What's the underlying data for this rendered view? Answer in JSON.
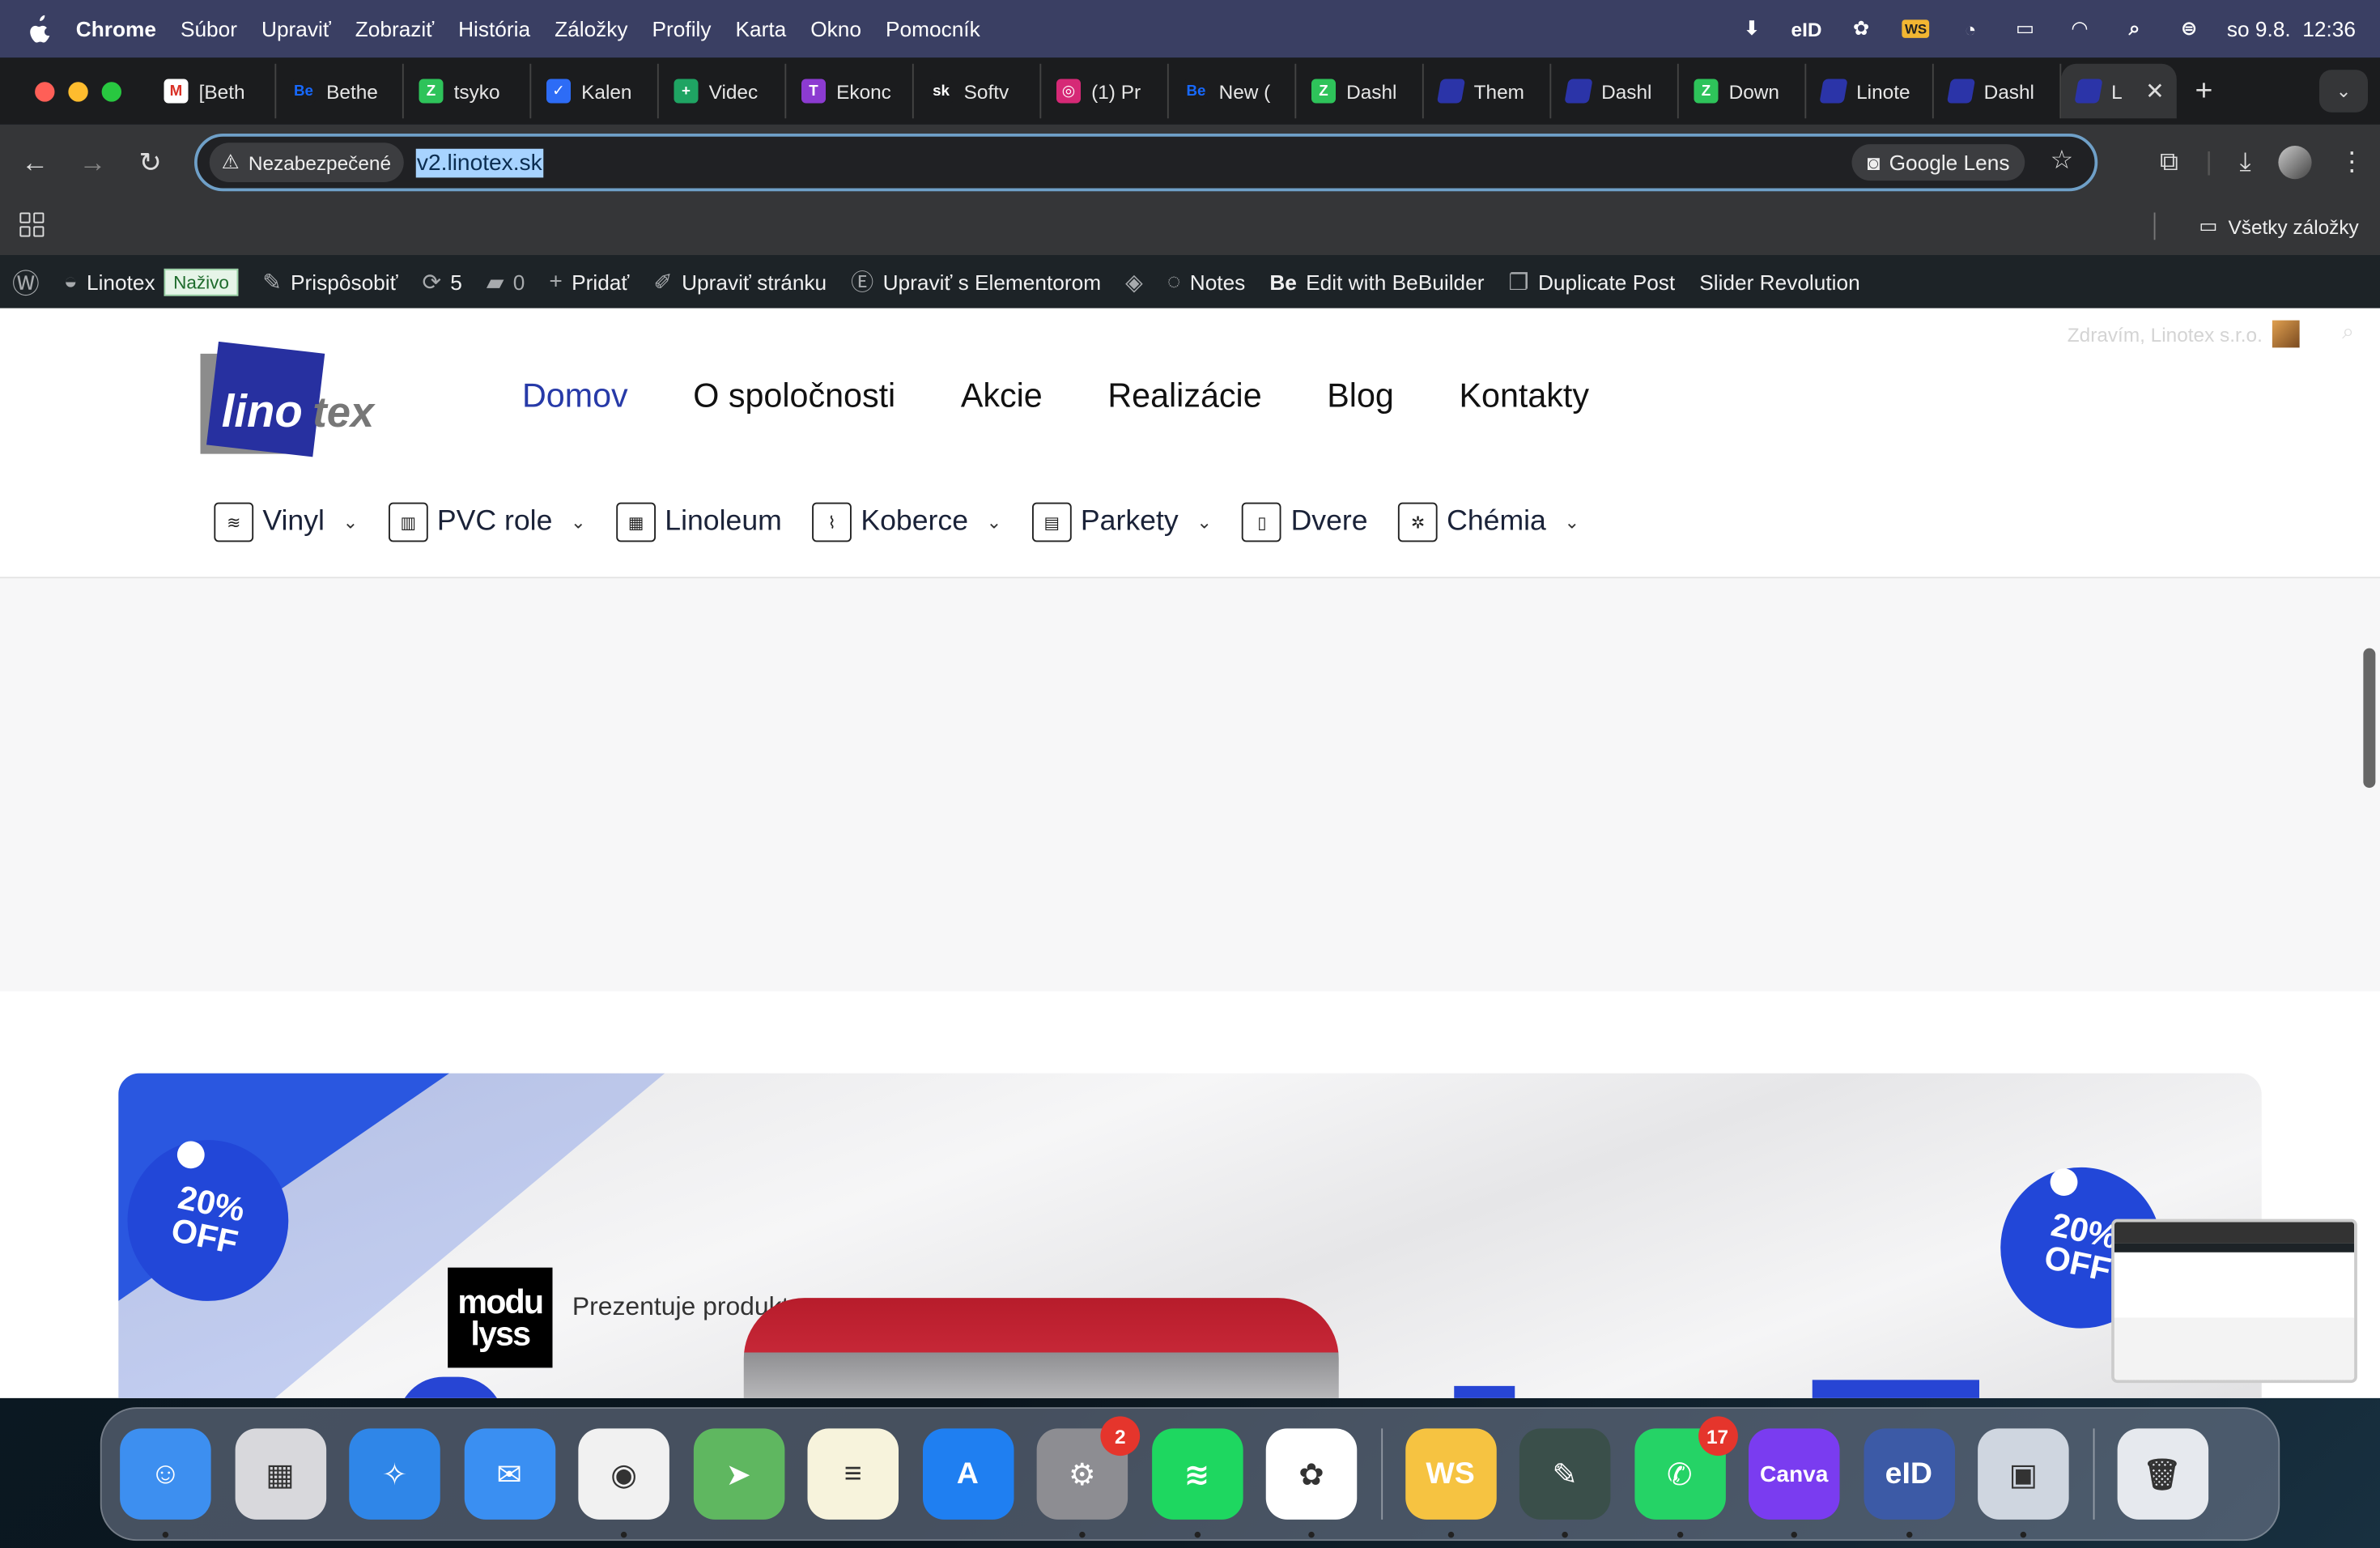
{
  "menubar": {
    "app": "Chrome",
    "items": [
      "Súbor",
      "Upraviť",
      "Zobraziť",
      "História",
      "Záložky",
      "Profily",
      "Karta",
      "Okno",
      "Pomocník"
    ],
    "status_ws": "WS",
    "status_eid": "eID",
    "datetime": "so 9.8.  12:36"
  },
  "tabs": [
    {
      "label": "[Beth",
      "icon": "gmail-icon",
      "color": "#ffffff",
      "glyph": "M",
      "gcolor": "#d93025"
    },
    {
      "label": "Bethe",
      "icon": "behance-icon",
      "color": "#1b1c1e",
      "glyph": "Be",
      "gcolor": "#1769ff"
    },
    {
      "label": "tsyko",
      "icon": "green-app-icon",
      "color": "#2ec35a",
      "glyph": "Z",
      "gcolor": "#fff"
    },
    {
      "label": "Kalen",
      "icon": "check-icon",
      "color": "#2d6cf6",
      "glyph": "✓",
      "gcolor": "#fff"
    },
    {
      "label": "Videc",
      "icon": "sheets-icon",
      "color": "#1fa463",
      "glyph": "+",
      "gcolor": "#fff"
    },
    {
      "label": "Ekonc",
      "icon": "t-app-icon",
      "color": "#8c3bd1",
      "glyph": "T",
      "gcolor": "#fff"
    },
    {
      "label": "Softv",
      "icon": "sk-icon",
      "color": "#1b1c1e",
      "glyph": "sk",
      "gcolor": "#fff"
    },
    {
      "label": "(1) Pr",
      "icon": "instagram-icon",
      "color": "#d62976",
      "glyph": "◎",
      "gcolor": "#fff"
    },
    {
      "label": "New (",
      "icon": "behance-icon",
      "color": "#1b1c1e",
      "glyph": "Be",
      "gcolor": "#1769ff"
    },
    {
      "label": "Dashl",
      "icon": "green-app-icon",
      "color": "#2ec35a",
      "glyph": "Z",
      "gcolor": "#fff"
    },
    {
      "label": "Them",
      "icon": "linotex-icon",
      "color": "#2b34a8",
      "glyph": "",
      "gcolor": "#fff"
    },
    {
      "label": "Dashl",
      "icon": "linotex-icon",
      "color": "#2b34a8",
      "glyph": "",
      "gcolor": "#fff"
    },
    {
      "label": "Down",
      "icon": "green-app-icon",
      "color": "#2ec35a",
      "glyph": "Z",
      "gcolor": "#fff"
    },
    {
      "label": "Linote",
      "icon": "linotex-icon",
      "color": "#2b34a8",
      "glyph": "",
      "gcolor": "#fff"
    },
    {
      "label": "Dashl",
      "icon": "linotex-icon",
      "color": "#2b34a8",
      "glyph": "",
      "gcolor": "#fff"
    }
  ],
  "active_tab": {
    "label": "L",
    "icon": "linotex-icon",
    "color": "#2b34a8"
  },
  "toolbar": {
    "security_chip": "Nezabezpečené",
    "url": "v2.linotex.sk",
    "lens": "Google Lens"
  },
  "bookmarks": {
    "all": "Všetky záložky"
  },
  "wpbar": {
    "site": "Linotex",
    "live": "Naživo",
    "customize": "Prispôsobiť",
    "updates": "5",
    "comments": "0",
    "add": "Pridať",
    "edit": "Upraviť stránku",
    "elementor": "Upraviť s Elementorom",
    "notes": "Notes",
    "bebuilder": "Edit with BeBuilder",
    "duplicate": "Duplicate Post",
    "slider": "Slider Revolution"
  },
  "page": {
    "greeting": "Zdravím, Linotex s.r.o.",
    "logo_text_1": "lino",
    "logo_text_2": "tex",
    "nav": [
      "Domov",
      "O spoločnosti",
      "Akcie",
      "Realizácie",
      "Blog",
      "Kontakty"
    ],
    "categories": [
      {
        "label": "Vinyl",
        "dropdown": true,
        "icon": "layers-icon"
      },
      {
        "label": "PVC role",
        "dropdown": true,
        "icon": "roll-icon"
      },
      {
        "label": "Linoleum",
        "dropdown": false,
        "icon": "tiles-icon"
      },
      {
        "label": "Koberce",
        "dropdown": true,
        "icon": "carpet-icon"
      },
      {
        "label": "Parkety",
        "dropdown": true,
        "icon": "parquet-icon"
      },
      {
        "label": "Dvere",
        "dropdown": false,
        "icon": "door-icon"
      },
      {
        "label": "Chémia",
        "dropdown": true,
        "icon": "chemistry-icon"
      }
    ],
    "promo": {
      "badge_pct": "20%",
      "badge_off": "OFF",
      "brand_1": "modu",
      "brand_2": "lyss",
      "presents": "Prezentuje produkt"
    }
  },
  "dock": [
    {
      "name": "finder",
      "color": "#3d8ff0",
      "glyph": "☺",
      "badge": "",
      "running": true
    },
    {
      "name": "launchpad",
      "color": "#d8d8dc",
      "glyph": "▦",
      "badge": "",
      "running": false
    },
    {
      "name": "safari",
      "color": "#2f86e8",
      "glyph": "✧",
      "badge": "",
      "running": false
    },
    {
      "name": "mail",
      "color": "#3a8ff2",
      "glyph": "✉",
      "badge": "",
      "running": false
    },
    {
      "name": "chrome",
      "color": "#f1f1f1",
      "glyph": "◉",
      "badge": "",
      "running": true
    },
    {
      "name": "maps",
      "color": "#5fb760",
      "glyph": "➤",
      "badge": "",
      "running": false
    },
    {
      "name": "notes",
      "color": "#f7f3dc",
      "glyph": "≡",
      "badge": "",
      "running": false
    },
    {
      "name": "app-store",
      "color": "#1f7ff1",
      "glyph": "A",
      "badge": "",
      "running": false
    },
    {
      "name": "system-settings",
      "color": "#8d8d92",
      "glyph": "⚙",
      "badge": "2",
      "running": true
    },
    {
      "name": "spotify",
      "color": "#1ed760",
      "glyph": "≋",
      "badge": "",
      "running": true
    },
    {
      "name": "chatgpt",
      "color": "#ffffff",
      "glyph": "✿",
      "badge": "",
      "running": true
    },
    {
      "name": "sep",
      "color": "",
      "glyph": "",
      "badge": "",
      "running": false
    },
    {
      "name": "ws-app",
      "color": "#f6c341",
      "glyph": "WS",
      "badge": "",
      "running": true
    },
    {
      "name": "brush-app",
      "color": "#3a4f4a",
      "glyph": "✎",
      "badge": "",
      "running": true
    },
    {
      "name": "whatsapp",
      "color": "#25d366",
      "glyph": "✆",
      "badge": "17",
      "running": true
    },
    {
      "name": "canva",
      "color": "#7a3cf0",
      "glyph": "Canva",
      "badge": "",
      "running": true
    },
    {
      "name": "eid",
      "color": "#3c5aa6",
      "glyph": "eID",
      "badge": "",
      "running": true
    },
    {
      "name": "preview",
      "color": "#cfd6e0",
      "glyph": "▣",
      "badge": "",
      "running": true
    },
    {
      "name": "sep",
      "color": "",
      "glyph": "",
      "badge": "",
      "running": false
    },
    {
      "name": "trash",
      "color": "#e6e9ee",
      "glyph": "🗑",
      "badge": "",
      "running": false
    }
  ]
}
